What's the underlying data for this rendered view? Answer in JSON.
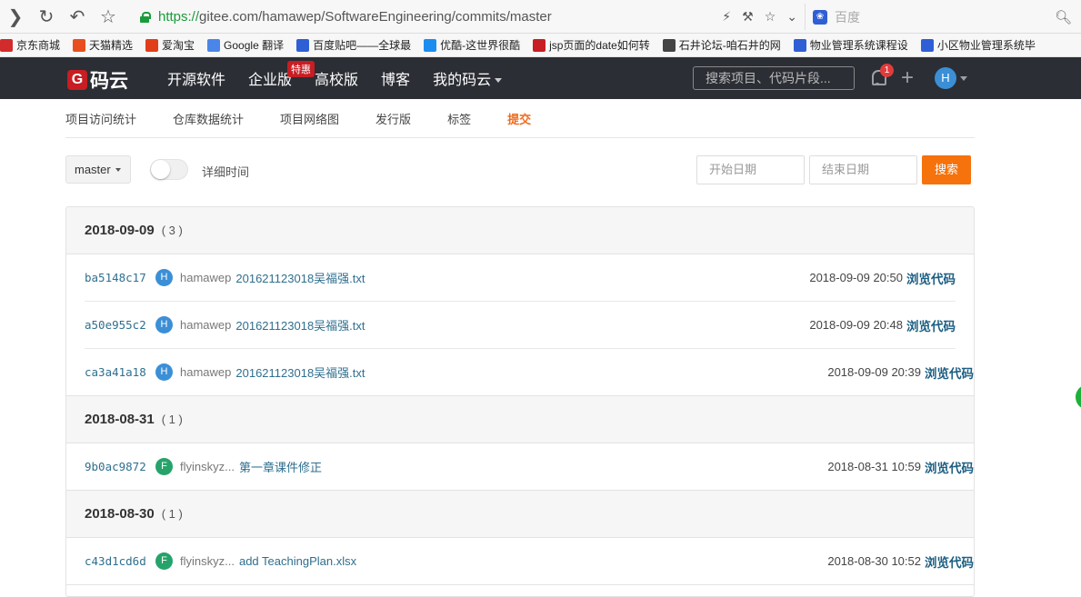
{
  "browser": {
    "url_scheme": "https://",
    "url_rest": "gitee.com/hamawep/SoftwareEngineering/commits/master",
    "search_engine_placeholder": "百度"
  },
  "bookmarks": [
    {
      "label": "京东商城",
      "color": "#d12b2b"
    },
    {
      "label": "天猫精选",
      "color": "#e94f1e"
    },
    {
      "label": "爱淘宝",
      "color": "#e23d1a"
    },
    {
      "label": "Google 翻译",
      "color": "#4a86e8"
    },
    {
      "label": "百度贴吧——全球最",
      "color": "#2f5fd5"
    },
    {
      "label": "优酷-这世界很酷",
      "color": "#1d8cf0"
    },
    {
      "label": "jsp页面的date如何转",
      "color": "#c71d23"
    },
    {
      "label": "石井论坛-咱石井的网",
      "color": "#444444"
    },
    {
      "label": "物业管理系统课程设",
      "color": "#2f5fd5"
    },
    {
      "label": "小区物业管理系统毕",
      "color": "#2f5fd5"
    }
  ],
  "header": {
    "logo_letter": "G",
    "logo_text": "码云",
    "nav": [
      "开源软件",
      "企业版",
      "高校版",
      "博客",
      "我的码云"
    ],
    "badge": "特惠",
    "search_placeholder": "搜索项目、代码片段...",
    "notification_count": "1",
    "plus_glyph": "+",
    "avatar_letter": "H"
  },
  "subtabs": [
    {
      "label": "项目访问统计",
      "active": false
    },
    {
      "label": "仓库数据统计",
      "active": false
    },
    {
      "label": "项目网络图",
      "active": false
    },
    {
      "label": "发行版",
      "active": false
    },
    {
      "label": "标签",
      "active": false
    },
    {
      "label": "提交",
      "active": true
    }
  ],
  "toolbar": {
    "branch": "master",
    "detail_time_label": "详细时间",
    "start_date_placeholder": "开始日期",
    "end_date_placeholder": "结束日期",
    "search_label": "搜索"
  },
  "groups": [
    {
      "date": "2018-09-09",
      "count": "( 3 )",
      "commits": [
        {
          "sha": "ba5148c17",
          "avatar": "H",
          "avatar_color": "#3b8fd6",
          "author": "hamawep",
          "message": "201621123018吴福强.txt",
          "time": "2018-09-09 20:50",
          "browse": "浏览代码"
        },
        {
          "sha": "a50e955c2",
          "avatar": "H",
          "avatar_color": "#3b8fd6",
          "author": "hamawep",
          "message": "201621123018吴福强.txt",
          "time": "2018-09-09 20:48",
          "browse": "浏览代码"
        },
        {
          "sha": "ca3a41a18",
          "avatar": "H",
          "avatar_color": "#3b8fd6",
          "author": "hamawep",
          "message": "201621123018吴福强.txt",
          "time": "2018-09-09 20:39",
          "browse": "浏览代码"
        }
      ]
    },
    {
      "date": "2018-08-31",
      "count": "( 1 )",
      "commits": [
        {
          "sha": "9b0ac9872",
          "avatar": "F",
          "avatar_color": "#26a36a",
          "author": "flyinskyz...",
          "message": "第一章课件修正",
          "time": "2018-08-31 10:59",
          "browse": "浏览代码"
        }
      ]
    },
    {
      "date": "2018-08-30",
      "count": "( 1 )",
      "commits": [
        {
          "sha": "c43d1cd6d",
          "avatar": "F",
          "avatar_color": "#26a36a",
          "author": "flyinskyz...",
          "message": "add TeachingPlan.xlsx",
          "time": "2018-08-30 10:52",
          "browse": "浏览代码"
        }
      ]
    }
  ]
}
